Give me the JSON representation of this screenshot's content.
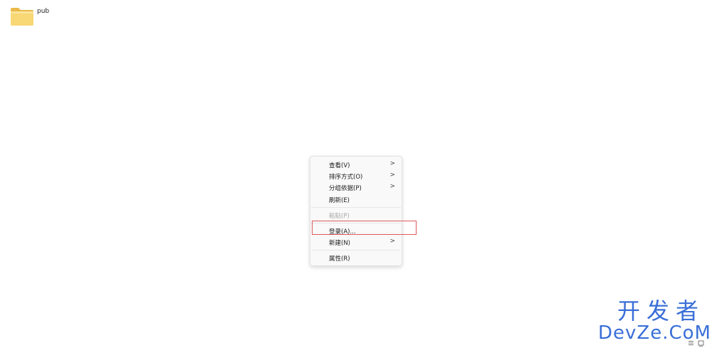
{
  "desktop": {
    "items": [
      {
        "label": "pub",
        "icon": "folder-icon"
      }
    ]
  },
  "context_menu": {
    "items": [
      {
        "label": "查看(V)",
        "has_submenu": true,
        "disabled": false
      },
      {
        "label": "排序方式(O)",
        "has_submenu": true,
        "disabled": false
      },
      {
        "label": "分组依据(P)",
        "has_submenu": true,
        "disabled": false
      },
      {
        "label": "刷新(E)",
        "has_submenu": false,
        "disabled": false
      },
      {
        "label": "粘贴(P)",
        "has_submenu": false,
        "disabled": true
      },
      {
        "label": "登录(A)...",
        "has_submenu": false,
        "disabled": false,
        "highlighted": true
      },
      {
        "label": "新建(N)",
        "has_submenu": true,
        "disabled": false
      },
      {
        "label": "属性(R)",
        "has_submenu": false,
        "disabled": false
      }
    ],
    "submenu_glyph": ">"
  },
  "watermark": {
    "line1": "开发者",
    "line2": "DevZe.CoM"
  },
  "status_bar": {
    "icons": [
      "details-view-icon",
      "large-icons-view-icon"
    ]
  },
  "colors": {
    "highlight_border": "#e05a5a",
    "watermark": "#3a6fd8",
    "folder_front": "#f8d775",
    "folder_back": "#e9b94a"
  }
}
